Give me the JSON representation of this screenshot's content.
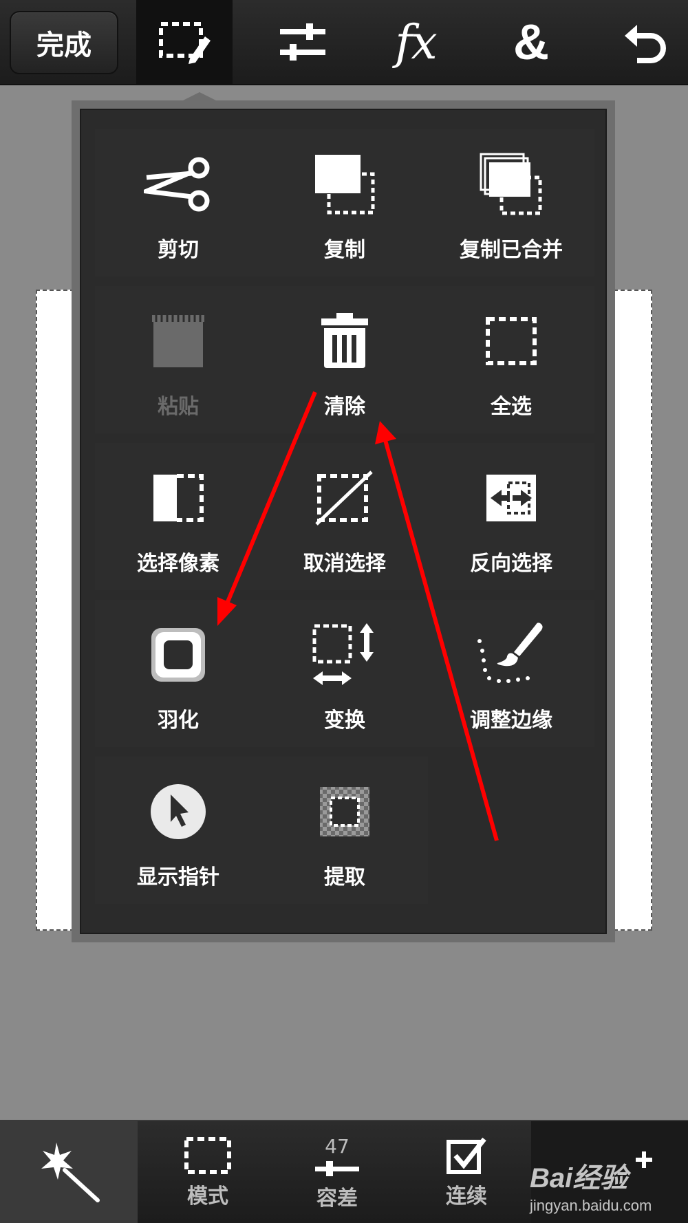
{
  "topbar": {
    "done_label": "完成",
    "tools": [
      {
        "name": "selection-edit",
        "icon": "selection-pencil-icon",
        "selected": true
      },
      {
        "name": "adjust",
        "icon": "sliders-icon"
      },
      {
        "name": "effects",
        "icon": "fx-icon",
        "glyph": "fx"
      },
      {
        "name": "layers",
        "icon": "ampersand-icon",
        "glyph": "&"
      },
      {
        "name": "undo",
        "icon": "undo-icon"
      }
    ]
  },
  "menu": {
    "items": [
      {
        "label": "剪切",
        "icon": "scissors-icon"
      },
      {
        "label": "复制",
        "icon": "copy-icon"
      },
      {
        "label": "复制已合并",
        "icon": "copy-merged-icon"
      },
      {
        "label": "粘贴",
        "icon": "paste-icon",
        "disabled": true
      },
      {
        "label": "清除",
        "icon": "trash-icon"
      },
      {
        "label": "全选",
        "icon": "select-all-icon"
      },
      {
        "label": "选择像素",
        "icon": "select-pixels-icon"
      },
      {
        "label": "取消选择",
        "icon": "deselect-icon"
      },
      {
        "label": "反向选择",
        "icon": "invert-selection-icon"
      },
      {
        "label": "羽化",
        "icon": "feather-icon"
      },
      {
        "label": "变换",
        "icon": "transform-icon"
      },
      {
        "label": "调整边缘",
        "icon": "refine-edge-icon"
      },
      {
        "label": "显示指针",
        "icon": "show-pointer-icon"
      },
      {
        "label": "提取",
        "icon": "extract-icon"
      }
    ]
  },
  "bottombar": {
    "wand": {
      "icon": "magic-wand-icon"
    },
    "mode": {
      "label": "模式",
      "icon": "selection-rect-icon"
    },
    "tolerance": {
      "label": "容差",
      "value": "47",
      "icon": "slider-icon"
    },
    "contiguous": {
      "label": "连续",
      "icon": "checkbox-checked-icon"
    },
    "add": {
      "icon": "add-selection-icon"
    }
  },
  "watermark": {
    "logo": "Bai经验",
    "sub": "jingyan.baidu.com"
  },
  "colors": {
    "toolbar_bg": "#222222",
    "popup_bg": "#2b2b2b",
    "arrow": "#ff0000",
    "canvas_gray": "#8a8a8a"
  }
}
